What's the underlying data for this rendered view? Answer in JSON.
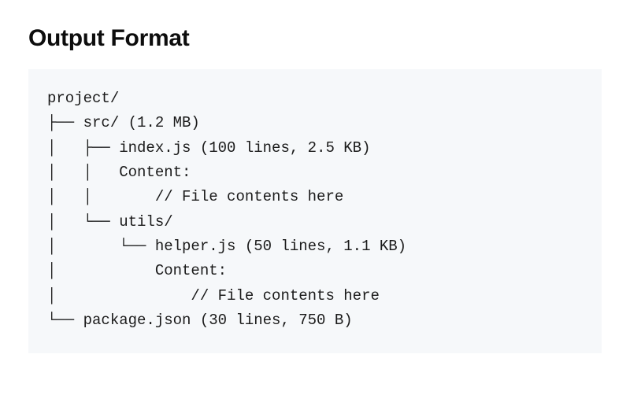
{
  "heading": "Output Format",
  "code_lines": [
    "project/",
    "├── src/ (1.2 MB)",
    "│   ├── index.js (100 lines, 2.5 KB)",
    "│   │   Content:",
    "│   │       // File contents here",
    "│   └── utils/",
    "│       └── helper.js (50 lines, 1.1 KB)",
    "│           Content:",
    "│               // File contents here",
    "└── package.json (30 lines, 750 B)"
  ]
}
